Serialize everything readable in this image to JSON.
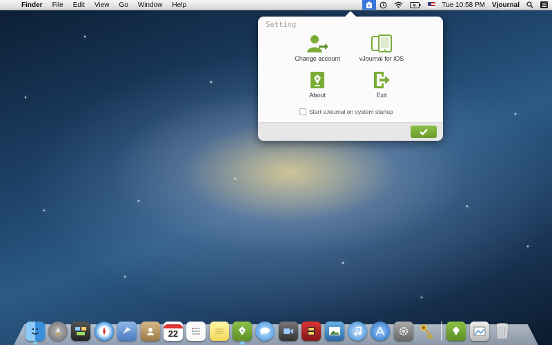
{
  "menubar": {
    "apple_symbol": "",
    "app_name": "Finder",
    "menus": [
      "File",
      "Edit",
      "View",
      "Go",
      "Window",
      "Help"
    ],
    "clock": "Tue 10:58 PM",
    "user": "Vjournal",
    "status_icons": [
      "vjournal-icon",
      "time-machine-icon",
      "wifi-icon",
      "battery-icon",
      "flag-icon",
      "spotlight-icon",
      "notification-icon"
    ]
  },
  "popover": {
    "title": "Setting",
    "options": [
      {
        "label": "Change account",
        "icon": "change-account-icon"
      },
      {
        "label": "vJournal for iOS",
        "icon": "ios-device-icon"
      },
      {
        "label": "About",
        "icon": "about-icon"
      },
      {
        "label": "Exit",
        "icon": "exit-icon"
      }
    ],
    "startup_label": "Start vJournal on system startup",
    "startup_checked": false,
    "ok_icon": "checkmark-icon",
    "accent_color": "#7aad38"
  },
  "dock": {
    "apps": [
      "finder",
      "launchpad",
      "mission-control",
      "safari",
      "mail",
      "contacts",
      "calendar",
      "reminders",
      "notes",
      "vjournal",
      "messages",
      "facetime",
      "photo-booth",
      "iphoto",
      "itunes",
      "app-store",
      "system-preferences",
      "keychain",
      "vjournal-doc",
      "preview",
      "trash"
    ],
    "calendar_day": "22"
  }
}
